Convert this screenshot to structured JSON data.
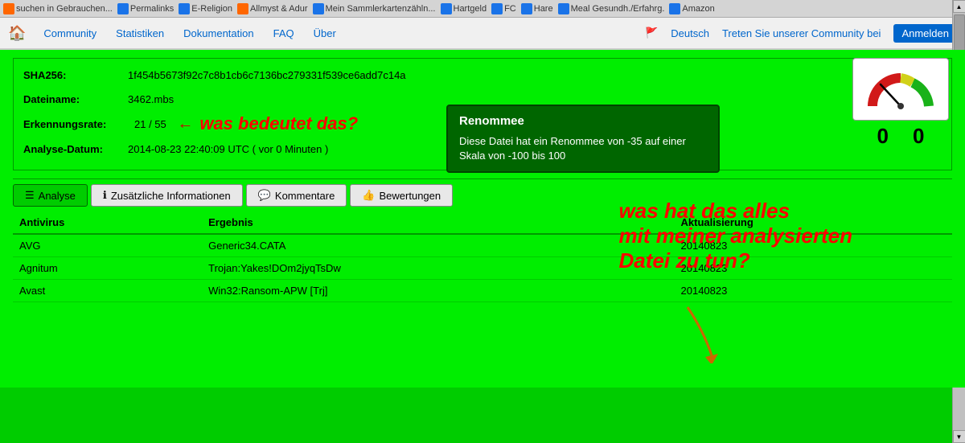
{
  "bookmarks": {
    "items": [
      {
        "label": "suchen in Gebrauchen...",
        "iconColor": "orange"
      },
      {
        "label": "Permalinks",
        "iconColor": "blue"
      },
      {
        "label": "E-Religion",
        "iconColor": "blue"
      },
      {
        "label": "Allmyst & Adur",
        "iconColor": "orange"
      },
      {
        "label": "Mein Sammlerkartenzähln...",
        "iconColor": "blue"
      },
      {
        "label": "Hartgeld",
        "iconColor": "blue"
      },
      {
        "label": "FC",
        "iconColor": "blue"
      },
      {
        "label": "Hare",
        "iconColor": "blue"
      },
      {
        "label": "Meal Gesundh./Erfahrg.",
        "iconColor": "blue"
      },
      {
        "label": "Amazon",
        "iconColor": "blue"
      }
    ]
  },
  "navbar": {
    "home_icon": "🏠",
    "links": [
      {
        "label": "Community"
      },
      {
        "label": "Statistiken"
      },
      {
        "label": "Dokumentation"
      },
      {
        "label": "FAQ"
      },
      {
        "label": "Über"
      }
    ],
    "language_flag": "🚩",
    "language": "Deutsch",
    "community_cta": "Treten Sie unserer Community bei",
    "login": "Anmelden"
  },
  "file_info": {
    "sha256_label": "SHA256:",
    "sha256_value": "1f454b5673f92c7c8b1cb6c7136bc279331f539ce6add7c14a",
    "dateiname_label": "Dateiname:",
    "dateiname_value": "3462.mbs",
    "erkennungsrate_label": "Erkennungsrate:",
    "erkennungsrate_value": "21 / 55",
    "annotation_arrow": "←",
    "annotation_text": "was bedeutet das?",
    "analyse_datum_label": "Analyse-Datum:",
    "analyse_datum_value": "2014-08-23 22:40:09 UTC ( vor 0 Minuten )"
  },
  "tooltip": {
    "title": "Renommee",
    "body": "Diese Datei hat ein Renommee von -35 auf einer Skala von -100 bis 100"
  },
  "gauge": {
    "value1": "0",
    "value2": "0"
  },
  "large_annotation": {
    "line1": "was hat das alles",
    "line2": "mit meiner analysierten",
    "line3": "Datei zu tun?"
  },
  "tabs": [
    {
      "icon": "☰",
      "label": "Analyse",
      "active": true
    },
    {
      "icon": "ℹ",
      "label": "Zusätzliche Informationen",
      "active": false
    },
    {
      "icon": "💬",
      "label": "Kommentare",
      "active": false
    },
    {
      "icon": "👍",
      "label": "Bewertungen",
      "active": false
    }
  ],
  "table": {
    "headers": [
      "Antivirus",
      "Ergebnis",
      "Aktualisierung"
    ],
    "rows": [
      {
        "antivirus": "AVG",
        "ergebnis": "Generic34.CATA",
        "aktualisierung": "20140823"
      },
      {
        "antivirus": "Agnitum",
        "ergebnis": "Trojan:Yakes!DOm2jyqTsDw",
        "aktualisierung": "20140823"
      },
      {
        "antivirus": "Avast",
        "ergebnis": "Win32:Ransom-APW [Trj]",
        "aktualisierung": "20140823"
      }
    ]
  }
}
